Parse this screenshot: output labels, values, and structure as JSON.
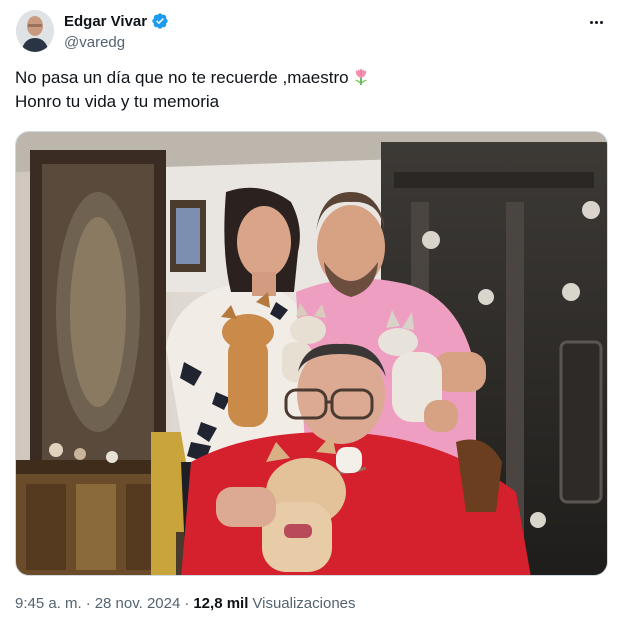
{
  "author": {
    "display_name": "Edgar Vivar",
    "handle": "@varedg",
    "verified_color": "#1d9bf0"
  },
  "tweet": {
    "line1": "No pasa un día que no te recuerde ,maestro",
    "line2": "Honro tu vida y tu memoria",
    "emoji": "tulip-emoji"
  },
  "meta": {
    "time": "9:45 a. m.",
    "separator1": "·",
    "date": "28 nov. 2024",
    "separator2": "·",
    "views_count": "12,8 mil",
    "views_label": "Visualizaciones"
  },
  "icons": {
    "more": "more-options-icon",
    "verified": "verified-badge-icon"
  },
  "colors": {
    "text_primary": "#0f1419",
    "text_secondary": "#536471",
    "accent": "#1d9bf0"
  }
}
